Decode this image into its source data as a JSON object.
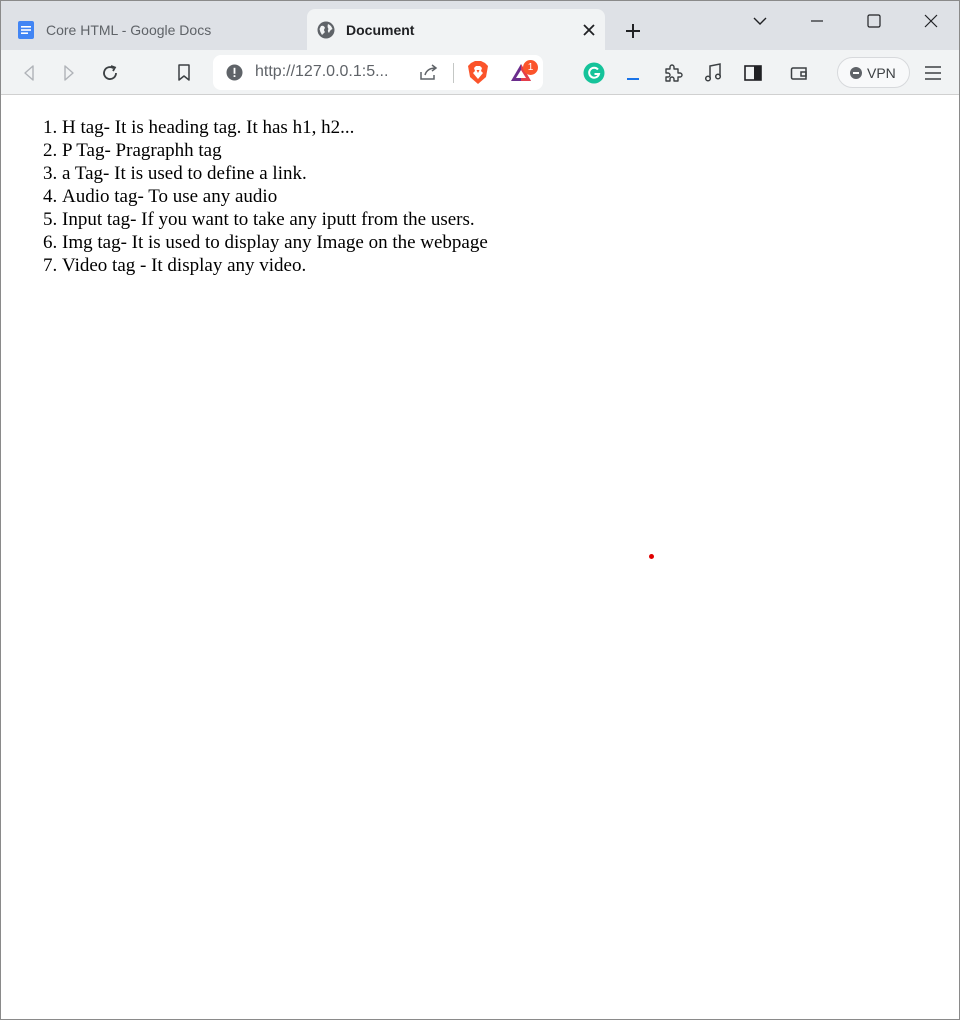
{
  "tabs": [
    {
      "title": "Core HTML - Google Docs",
      "icon": "google-docs-icon",
      "active": false
    },
    {
      "title": "Document",
      "icon": "globe-icon",
      "active": true
    }
  ],
  "toolbar": {
    "url": "http://127.0.0.1:5...",
    "vpn_label": "VPN",
    "rewards_badge": "1"
  },
  "colors": {
    "tab_strip": "#dee1e6",
    "toolbar": "#f1f3f4",
    "docs_blue": "#4285f4",
    "brave_orange": "#fb542b",
    "grammarly_green": "#15c39a"
  },
  "content": {
    "items": [
      "H tag- It is heading tag. It has h1, h2...",
      "P Tag- Pragraphh tag",
      "a Tag- It is used to define a link.",
      "Audio tag- To use any audio",
      "Input tag- If you want to take any iputt from the users.",
      "Img tag- It is used to display any Image on the webpage",
      "Video tag - It display any video."
    ]
  }
}
